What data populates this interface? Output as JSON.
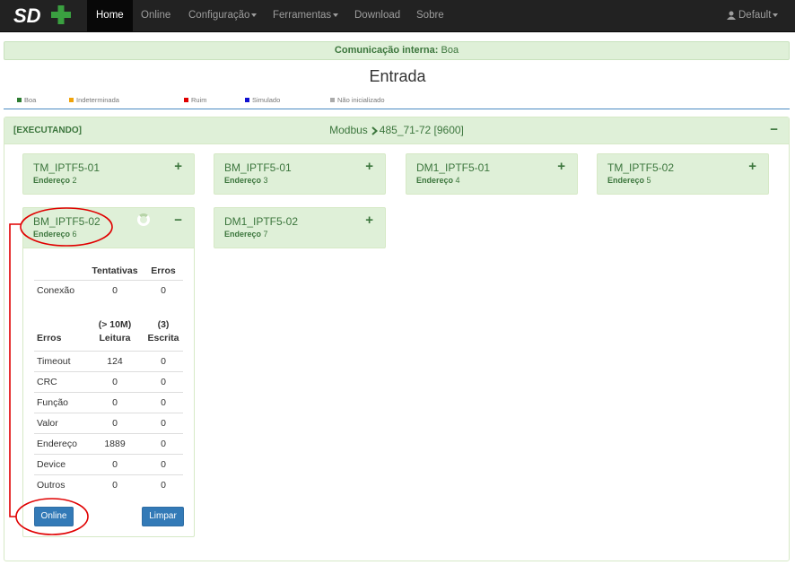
{
  "nav": {
    "logo_alt": "SD+",
    "items": [
      {
        "label": "Home"
      },
      {
        "label": "Online"
      },
      {
        "label": "Configuração"
      },
      {
        "label": "Ferramentas"
      },
      {
        "label": "Download"
      },
      {
        "label": "Sobre"
      }
    ],
    "user": "Default"
  },
  "comm": {
    "label": "Comunicação interna:",
    "value": "Boa"
  },
  "page_title": "Entrada",
  "legend": [
    {
      "label": "Boa",
      "color": "#2e7d32"
    },
    {
      "label": "Indeterminada",
      "color": "#f0a30a"
    },
    {
      "label": "Ruim",
      "color": "#e00000"
    },
    {
      "label": "Simulado",
      "color": "#1010d0"
    },
    {
      "label": "Não inicializado",
      "color": "#aaaaaa"
    }
  ],
  "panel": {
    "status": "[EXECUTANDO]",
    "protocol": "Modbus",
    "port": "485_71-72 [9600]",
    "collapse": "−"
  },
  "devices": [
    {
      "name": "TM_IPTF5-01",
      "addr_label": "Endereço",
      "addr": "2",
      "toggle": "+"
    },
    {
      "name": "BM_IPTF5-01",
      "addr_label": "Endereço",
      "addr": "3",
      "toggle": "+"
    },
    {
      "name": "DM1_IPTF5-01",
      "addr_label": "Endereço",
      "addr": "4",
      "toggle": "+"
    },
    {
      "name": "TM_IPTF5-02",
      "addr_label": "Endereço",
      "addr": "5",
      "toggle": "+"
    },
    {
      "name": "BM_IPTF5-02",
      "addr_label": "Endereço",
      "addr": "6",
      "toggle": "−"
    },
    {
      "name": "DM1_IPTF5-02",
      "addr_label": "Endereço",
      "addr": "7",
      "toggle": "+"
    }
  ],
  "conn_table": {
    "headers": [
      "",
      "Tentativas",
      "Erros"
    ],
    "rows": [
      [
        "Conexão",
        "0",
        "0"
      ]
    ]
  },
  "err_table": {
    "headers": [
      "Erros",
      "(> 10M) Leitura",
      "(3) Escrita"
    ],
    "h1": [
      "",
      "(> 10M)",
      "(3)"
    ],
    "h2": [
      "Erros",
      "Leitura",
      "Escrita"
    ],
    "rows": [
      [
        "Timeout",
        "124",
        "0"
      ],
      [
        "CRC",
        "0",
        "0"
      ],
      [
        "Função",
        "0",
        "0"
      ],
      [
        "Valor",
        "0",
        "0"
      ],
      [
        "Endereço",
        "1889",
        "0"
      ],
      [
        "Device",
        "0",
        "0"
      ],
      [
        "Outros",
        "0",
        "0"
      ]
    ]
  },
  "buttons": {
    "online": "Online",
    "clear": "Limpar"
  },
  "colors": {
    "navbar": "#222222",
    "success_bg": "#dff0d8",
    "success_text": "#3c763d",
    "primary": "#337ab7",
    "annotation": "#e00000"
  }
}
